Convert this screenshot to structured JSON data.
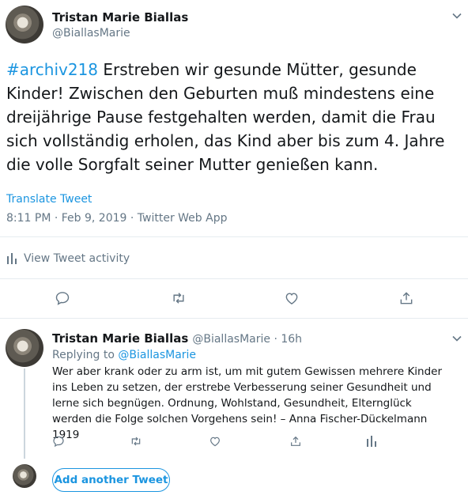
{
  "tweet": {
    "author_name": "Tristan Marie Biallas",
    "author_handle": "@BiallasMarie",
    "hashtag": "#archiv218",
    "text": " Erstreben wir gesunde Mütter, gesunde Kinder! Zwischen den Geburten muß mindestens eine dreijährige Pause festgehalten werden, damit die Frau sich vollständig erholen, das Kind aber bis zum 4. Jahre die volle Sorgfalt seiner Mutter genießen kann.",
    "translate_label": "Translate Tweet",
    "timestamp": "8:11 PM · Feb 9, 2019 · Twitter Web App",
    "activity_label": "View Tweet activity"
  },
  "reply": {
    "author_name": "Tristan Marie Biallas",
    "author_handle": "@BiallasMarie · 16h",
    "replying_to_prefix": "Replying to ",
    "replying_to_handle": "@BiallasMarie",
    "text": "Wer aber krank oder zu arm ist, um mit gutem Gewissen mehrere Kinder ins Leben zu setzen, der erstrebe Verbesserung seiner Gesundheit und lerne sich begnügen. Ordnung, Wohlstand, Gesundheit, Elternglück werden die Folge solchen Vorgehens sein! – Anna Fischer-Dückelmann  1919"
  },
  "composer": {
    "add_tweet_label": "Add another Tweet"
  },
  "colors": {
    "accent": "#1b95e0",
    "secondary_text": "#657786",
    "divider": "#e6ecf0"
  }
}
